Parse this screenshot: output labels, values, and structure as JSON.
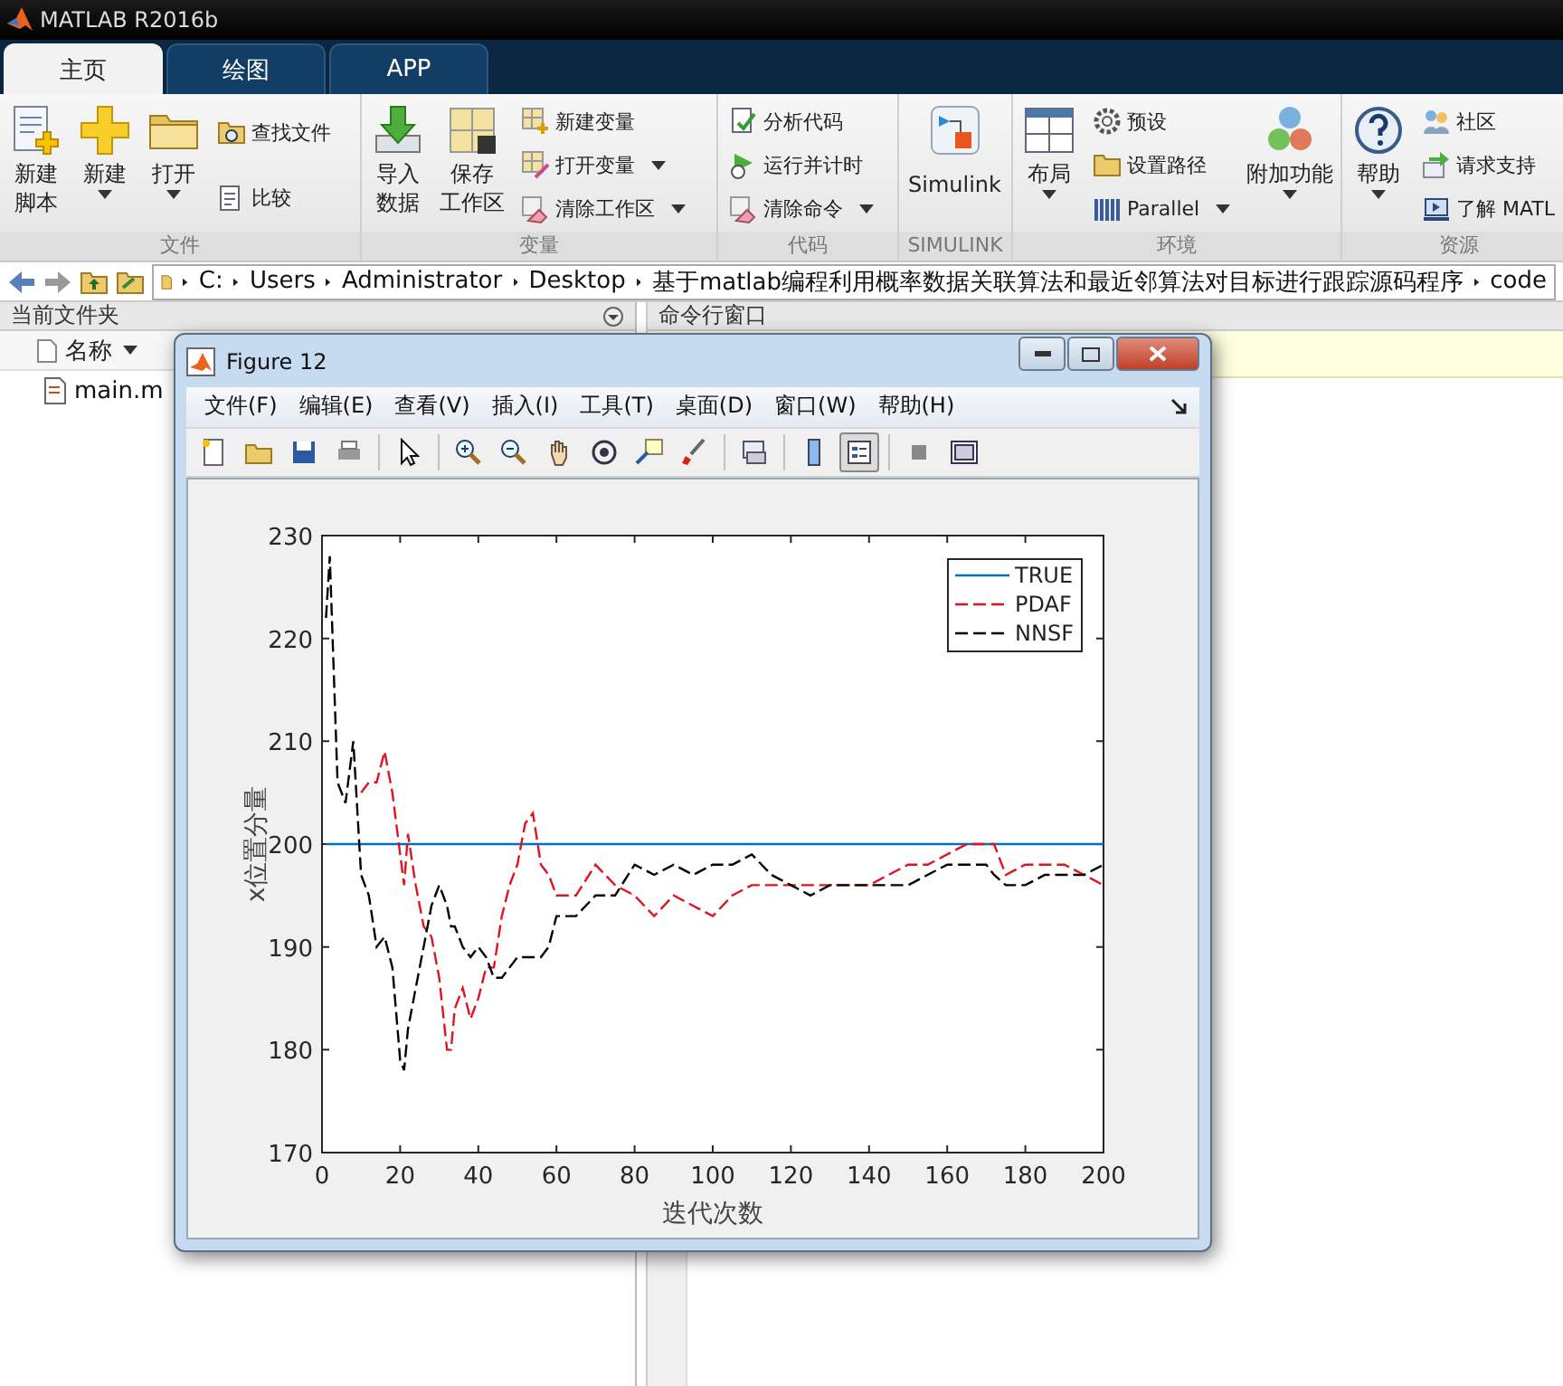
{
  "app": {
    "title": "MATLAB R2016b"
  },
  "tabs": [
    {
      "label": "主页",
      "selected": true
    },
    {
      "label": "绘图",
      "selected": false
    },
    {
      "label": "APP",
      "selected": false
    }
  ],
  "ribbon": {
    "groups": [
      {
        "label": "文件",
        "items": [
          {
            "kind": "large",
            "lines": [
              "新建",
              "脚本"
            ],
            "dropdown": false
          },
          {
            "kind": "large",
            "lines": [
              "新建"
            ],
            "dropdown": true
          },
          {
            "kind": "large",
            "lines": [
              "打开"
            ],
            "dropdown": true
          },
          {
            "kind": "stack",
            "entries": [
              {
                "label": "查找文件",
                "dropdown": false
              },
              {
                "label": "比较",
                "dropdown": false
              }
            ]
          }
        ]
      },
      {
        "label": "变量",
        "items": [
          {
            "kind": "large",
            "lines": [
              "导入",
              "数据"
            ],
            "dropdown": false
          },
          {
            "kind": "large",
            "lines": [
              "保存",
              "工作区"
            ],
            "dropdown": false
          },
          {
            "kind": "stack",
            "entries": [
              {
                "label": "新建变量",
                "dropdown": false
              },
              {
                "label": "打开变量",
                "dropdown": true
              },
              {
                "label": "清除工作区",
                "dropdown": true
              }
            ]
          }
        ]
      },
      {
        "label": "代码",
        "items": [
          {
            "kind": "stack",
            "entries": [
              {
                "label": "分析代码",
                "dropdown": false
              },
              {
                "label": "运行并计时",
                "dropdown": false
              },
              {
                "label": "清除命令",
                "dropdown": true
              }
            ]
          }
        ]
      },
      {
        "label": "SIMULINK",
        "items": [
          {
            "kind": "large",
            "lines": [
              "Simulink"
            ],
            "dropdown": false
          }
        ]
      },
      {
        "label": "环境",
        "items": [
          {
            "kind": "large",
            "lines": [
              "布局"
            ],
            "dropdown": true
          },
          {
            "kind": "stack",
            "entries": [
              {
                "label": "预设",
                "dropdown": false
              },
              {
                "label": "设置路径",
                "dropdown": false
              },
              {
                "label": "Parallel",
                "dropdown": true
              }
            ]
          },
          {
            "kind": "large",
            "lines": [
              "附加功能"
            ],
            "dropdown": true
          }
        ]
      },
      {
        "label": "资源",
        "items": [
          {
            "kind": "large",
            "lines": [
              "帮助"
            ],
            "dropdown": true
          },
          {
            "kind": "stack",
            "entries": [
              {
                "label": "社区",
                "dropdown": false
              },
              {
                "label": "请求支持",
                "dropdown": false
              },
              {
                "label": "了解 MATL",
                "dropdown": false
              }
            ]
          }
        ]
      }
    ]
  },
  "address_bar": {
    "segments": [
      "C:",
      "Users",
      "Administrator",
      "Desktop",
      "基于matlab编程利用概率数据关联算法和最近邻算法对目标进行跟踪源码程序",
      "code"
    ]
  },
  "file_panel": {
    "title": "当前文件夹",
    "column": "名称",
    "files": [
      "main.m"
    ]
  },
  "command_window": {
    "title": "命令行窗口"
  },
  "figure": {
    "title": "Figure 12",
    "menu": [
      "文件(F)",
      "编辑(E)",
      "查看(V)",
      "插入(I)",
      "工具(T)",
      "桌面(D)",
      "窗口(W)",
      "帮助(H)"
    ],
    "chart_data": {
      "type": "line",
      "xlabel": "迭代次数",
      "ylabel": "x位置分量",
      "x": [
        1,
        2,
        4,
        6,
        8,
        10,
        12,
        14,
        16,
        18,
        20,
        21,
        22,
        24,
        26,
        28,
        30,
        32,
        33,
        34,
        36,
        38,
        40,
        42,
        44,
        46,
        48,
        50,
        52,
        54,
        56,
        58,
        60,
        65,
        70,
        75,
        80,
        85,
        90,
        95,
        100,
        105,
        110,
        115,
        120,
        125,
        130,
        135,
        140,
        145,
        150,
        155,
        160,
        165,
        170,
        172,
        175,
        180,
        185,
        190,
        195,
        200
      ],
      "series": [
        {
          "name": "TRUE",
          "color": "#0072bd",
          "line_style": "solid",
          "values": [
            200,
            200,
            200,
            200,
            200,
            200,
            200,
            200,
            200,
            200,
            200,
            200,
            200,
            200,
            200,
            200,
            200,
            200,
            200,
            200,
            200,
            200,
            200,
            200,
            200,
            200,
            200,
            200,
            200,
            200,
            200,
            200,
            200,
            200,
            200,
            200,
            200,
            200,
            200,
            200,
            200,
            200,
            200,
            200,
            200,
            200,
            200,
            200,
            200,
            200,
            200,
            200,
            200,
            200,
            200,
            200,
            200,
            200,
            200,
            200,
            200,
            200
          ]
        },
        {
          "name": "PDAF",
          "color": "#e0141e",
          "line_style": "dashed",
          "values": [
            null,
            null,
            null,
            null,
            null,
            205,
            206,
            206,
            209,
            205,
            199,
            196,
            201,
            196,
            192,
            191,
            187,
            180,
            180,
            184,
            186,
            183,
            185,
            188,
            188,
            193,
            196,
            198,
            202,
            203,
            198,
            197,
            195,
            195,
            198,
            196,
            195,
            193,
            195,
            194,
            193,
            195,
            196,
            196,
            196,
            196,
            196,
            196,
            196,
            197,
            198,
            198,
            199,
            200,
            200,
            200,
            197,
            198,
            198,
            198,
            197,
            196
          ]
        },
        {
          "name": "NNSF",
          "color": "#000000",
          "line_style": "dashed",
          "values": [
            222,
            228,
            206,
            204,
            210,
            197,
            195,
            190,
            191,
            188,
            179,
            178,
            182,
            186,
            190,
            194,
            196,
            194,
            192,
            192,
            190,
            189,
            190,
            189,
            187,
            187,
            188,
            189,
            189,
            189,
            189,
            190,
            193,
            193,
            195,
            195,
            198,
            197,
            198,
            197,
            198,
            198,
            199,
            197,
            196,
            195,
            196,
            196,
            196,
            196,
            196,
            197,
            198,
            198,
            198,
            197,
            196,
            196,
            197,
            197,
            197,
            198
          ]
        }
      ],
      "legend": true,
      "xlim": [
        0,
        200
      ],
      "ylim": [
        170,
        230
      ],
      "xticks": [
        0,
        20,
        40,
        60,
        80,
        100,
        120,
        140,
        160,
        180,
        200
      ],
      "yticks": [
        170,
        180,
        190,
        200,
        210,
        220,
        230
      ]
    }
  }
}
